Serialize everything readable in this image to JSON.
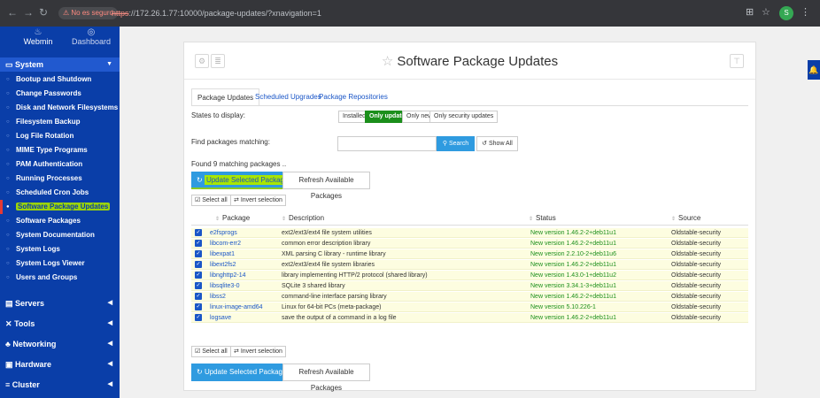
{
  "browser": {
    "insecure_label": "No es seguro",
    "url_proto": "https",
    "url_rest": "://172.26.1.77:10000/package-updates/?xnavigation=1",
    "avatar_letter": "S"
  },
  "sidebar": {
    "webmin_label": "Webmin",
    "dashboard_label": "Dashboard",
    "system_label": "System",
    "items": [
      "Bootup and Shutdown",
      "Change Passwords",
      "Disk and Network Filesystems",
      "Filesystem Backup",
      "Log File Rotation",
      "MIME Type Programs",
      "PAM Authentication",
      "Running Processes",
      "Scheduled Cron Jobs",
      "Software Package Updates",
      "Software Packages",
      "System Documentation",
      "System Logs",
      "System Logs Viewer",
      "Users and Groups"
    ],
    "categories": [
      "Servers",
      "Tools",
      "Networking",
      "Hardware",
      "Cluster"
    ]
  },
  "page": {
    "title": "Software Package Updates",
    "tabs": [
      "Package Updates",
      "Scheduled Upgrades",
      "Package Repositories"
    ],
    "states_label": "States to display:",
    "states": [
      "Installed",
      "Only updates",
      "Only new",
      "Only security updates"
    ],
    "find_label": "Find packages matching:",
    "search_label": "Search",
    "show_all_label": "Show All",
    "found_text": "Found 9 matching packages ..",
    "update_label": "Update Selected Packages",
    "refresh_label": "Refresh Available Packages",
    "select_all_label": "Select all",
    "invert_label": "Invert selection"
  },
  "table": {
    "headers": [
      "Package",
      "Description",
      "Status",
      "Source"
    ],
    "rows": [
      {
        "pkg": "e2fsprogs",
        "desc": "ext2/ext3/ext4 file system utilities",
        "status": "New version 1.46.2-2+deb11u1",
        "source": "Oldstable-security"
      },
      {
        "pkg": "libcom-err2",
        "desc": "common error description library",
        "status": "New version 1.46.2-2+deb11u1",
        "source": "Oldstable-security"
      },
      {
        "pkg": "libexpat1",
        "desc": "XML parsing C library - runtime library",
        "status": "New version 2.2.10-2+deb11u6",
        "source": "Oldstable-security"
      },
      {
        "pkg": "libext2fs2",
        "desc": "ext2/ext3/ext4 file system libraries",
        "status": "New version 1.46.2-2+deb11u1",
        "source": "Oldstable-security"
      },
      {
        "pkg": "libnghttp2-14",
        "desc": "library implementing HTTP/2 protocol (shared library)",
        "status": "New version 1.43.0-1+deb11u2",
        "source": "Oldstable-security"
      },
      {
        "pkg": "libsqlite3-0",
        "desc": "SQLite 3 shared library",
        "status": "New version 3.34.1-3+deb11u1",
        "source": "Oldstable-security"
      },
      {
        "pkg": "libss2",
        "desc": "command-line interface parsing library",
        "status": "New version 1.46.2-2+deb11u1",
        "source": "Oldstable-security"
      },
      {
        "pkg": "linux-image-amd64",
        "desc": "Linux for 64-bit PCs (meta-package)",
        "status": "New version 5.10.226-1",
        "source": "Oldstable-security"
      },
      {
        "pkg": "logsave",
        "desc": "save the output of a command in a log file",
        "status": "New version 1.46.2-2+deb11u1",
        "source": "Oldstable-security"
      }
    ]
  }
}
